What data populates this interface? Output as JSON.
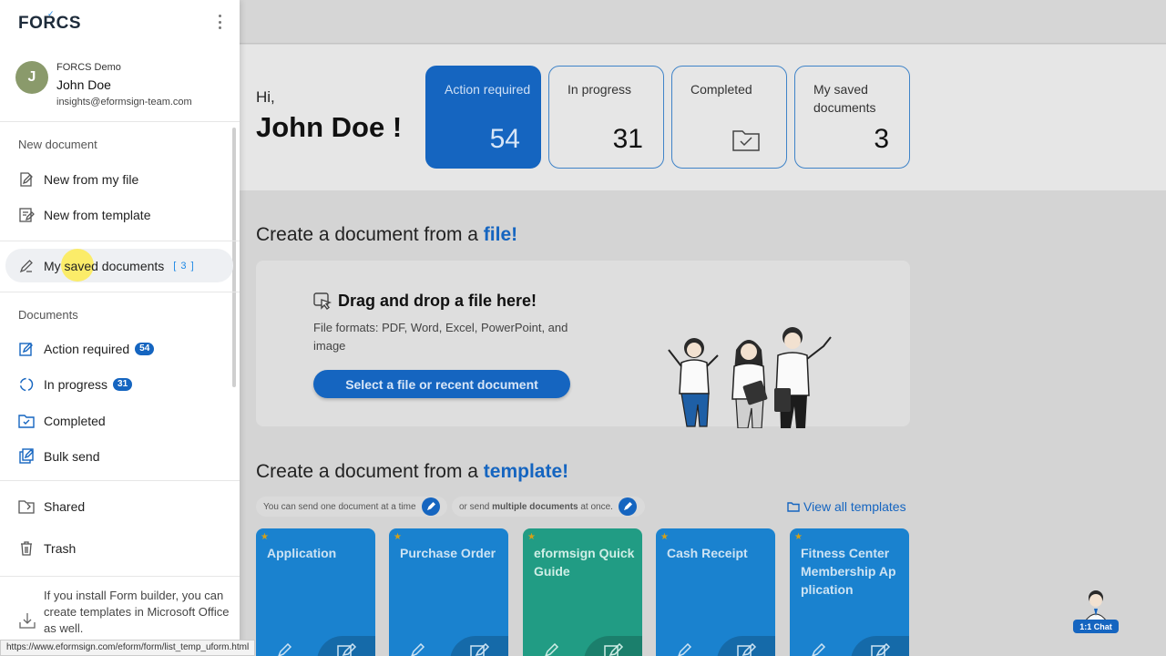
{
  "app": {
    "logo": "FORCS"
  },
  "profile": {
    "avatar_initial": "J",
    "org": "FORCS Demo",
    "name": "John Doe",
    "email": "insights@eformsign-team.com"
  },
  "sidebar": {
    "new_document_label": "New document",
    "new_items": [
      {
        "label": "New from my file",
        "icon": "file-edit-icon"
      },
      {
        "label": "New from template",
        "icon": "template-edit-icon"
      }
    ],
    "saved": {
      "label": "My saved documents",
      "count": "[ 3 ]",
      "icon": "pencil-icon"
    },
    "documents_label": "Documents",
    "doc_items": [
      {
        "label": "Action required",
        "badge": "54",
        "icon": "action-required-icon"
      },
      {
        "label": "In progress",
        "badge": "31",
        "icon": "in-progress-icon"
      },
      {
        "label": "Completed",
        "icon": "completed-folder-icon"
      },
      {
        "label": "Bulk send",
        "icon": "bulk-send-icon"
      }
    ],
    "other_items": [
      {
        "label": "Shared",
        "icon": "shared-folder-icon"
      },
      {
        "label": "Trash",
        "icon": "trash-icon"
      }
    ],
    "promo_text": "If you install Form builder, you can create templates in Microsoft Office as well."
  },
  "status_url": "https://www.eformsign.com/eform/form/list_temp_uform.html",
  "hero": {
    "greeting": "Hi,",
    "name": "John Doe !",
    "stats": [
      {
        "label": "Action required",
        "value": "54",
        "active": true
      },
      {
        "label": "In progress",
        "value": "31"
      },
      {
        "label": "Completed",
        "icon": "folder-check-icon"
      },
      {
        "label": "My saved documents",
        "value": "3"
      }
    ]
  },
  "file_section": {
    "heading_prefix": "Create a document from a",
    "heading_highlight": "file!",
    "drop_title": "Drag and drop a file here!",
    "formats": "File formats: PDF, Word, Excel, PowerPoint, and image",
    "select_button": "Select a file or recent document"
  },
  "template_section": {
    "heading_prefix": "Create a document from a",
    "heading_highlight": "template!",
    "pill_one": "You can send one document at a time",
    "pill_multi_prefix": "or send",
    "pill_multi_bold": "multiple documents",
    "pill_multi_suffix": "at once.",
    "view_all": "View all templates",
    "cards": [
      {
        "name": "Application",
        "color": "#1a82cf"
      },
      {
        "name": "Purchase Order",
        "color": "#1a82cf"
      },
      {
        "name": "eformsign Quick Guide",
        "color": "#219c84"
      },
      {
        "name": "Cash Receipt",
        "color": "#1a82cf"
      },
      {
        "name": "Fitness Center Membership Ap plication",
        "color": "#1a82cf"
      }
    ]
  },
  "chat": {
    "label": "1:1 Chat"
  },
  "colors": {
    "accent": "#1565c0",
    "overlay": "#d4d4d4",
    "template_blue": "#1a82cf",
    "template_green": "#219c84"
  }
}
